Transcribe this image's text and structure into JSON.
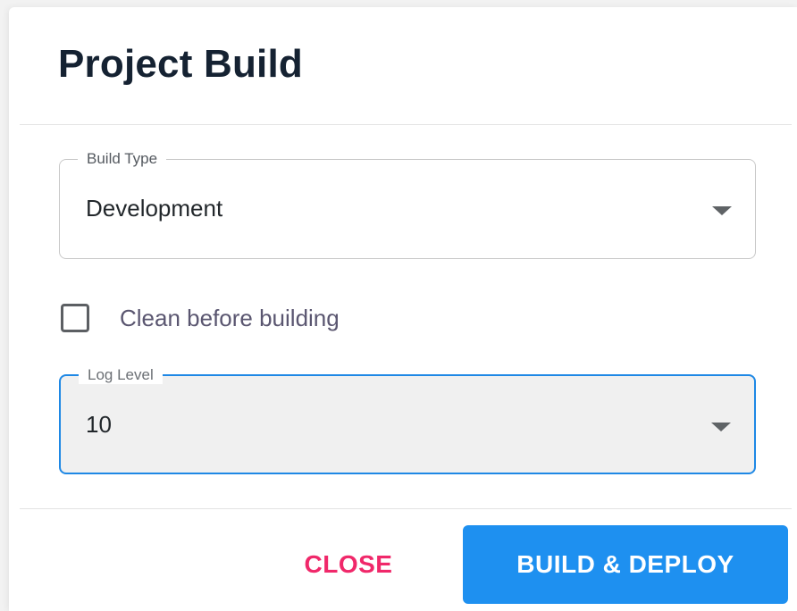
{
  "dialog": {
    "title": "Project Build"
  },
  "build_type": {
    "label": "Build Type",
    "value": "Development"
  },
  "clean_option": {
    "label": "Clean before building",
    "checked": false
  },
  "log_level": {
    "label": "Log Level",
    "value": "10",
    "focused": true
  },
  "actions": {
    "close_label": "CLOSE",
    "build_label": "BUILD & DEPLOY"
  },
  "colors": {
    "primary": "#1e90f0",
    "close_text": "#f0286a",
    "title_text": "#152232",
    "focus_border": "#1e88e5"
  },
  "icons": {
    "build_type_caret": "caret-down-icon",
    "log_level_caret": "caret-down-icon"
  }
}
